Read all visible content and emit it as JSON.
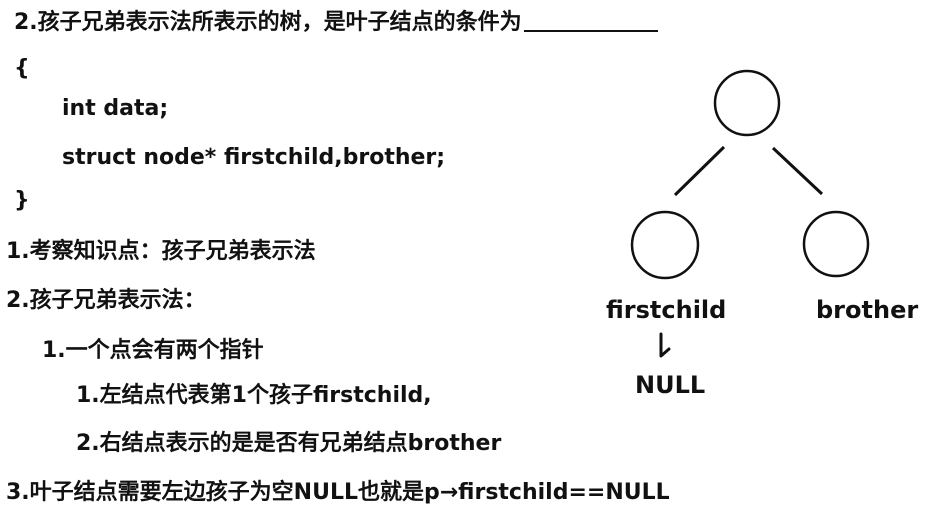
{
  "question": {
    "title": "2.孩子兄弟表示法所表示的树，是叶子结点的条件为",
    "code": [
      "{",
      "int data;",
      "struct node* firstchild,brother;",
      "}"
    ]
  },
  "notes": [
    "1.考察知识点：孩子兄弟表示法",
    "2.孩子兄弟表示法：",
    "1.一个点会有两个指针",
    "1.左结点代表第1个孩子firstchild,",
    "2.右结点表示的是是否有兄弟结点brother",
    "3.叶子结点需要左边孩子为空NULL也就是p→firstchild==NULL"
  ],
  "diagram": {
    "left_label": "firstchild",
    "right_label": "brother",
    "null_label": "NULL"
  }
}
